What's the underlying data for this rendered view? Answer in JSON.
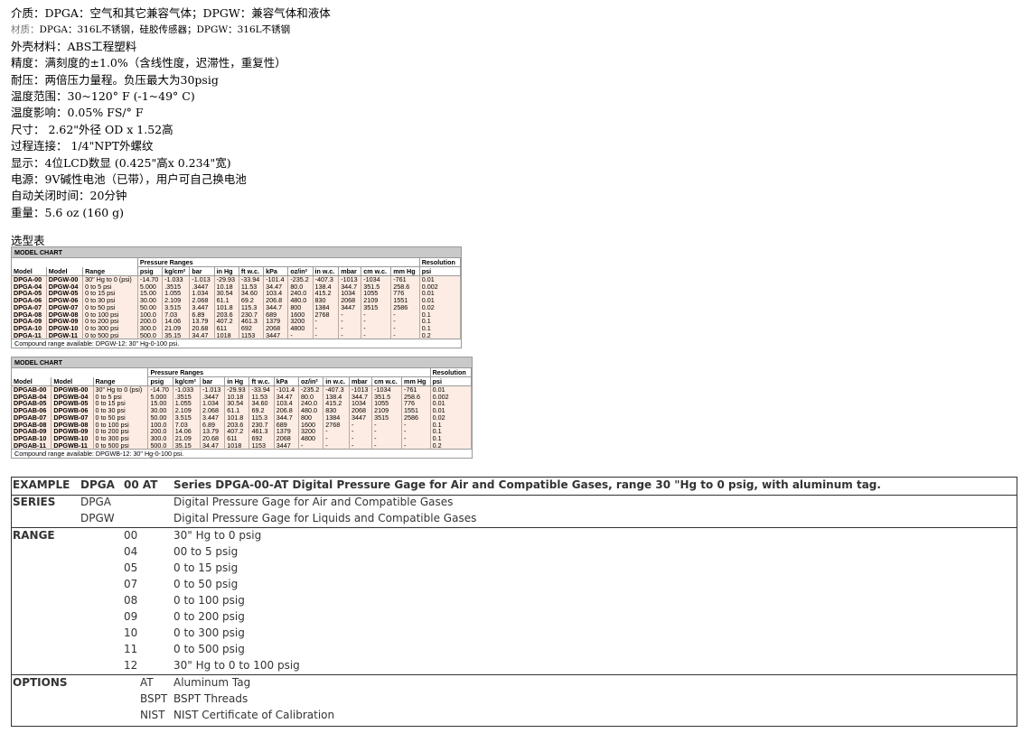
{
  "specs": [
    {
      "text": "介质：DPGA：空气和其它兼容气体；DPGW：兼容气体和液体",
      "style": "normal"
    },
    {
      "label": "材质：",
      "text": "DPGA：316L不锈钢，硅胶传感器；DPGW：316L不锈钢",
      "style": "small"
    },
    {
      "text": "外壳材料：ABS工程塑料",
      "style": "normal"
    },
    {
      "text": "精度：满刻度的±1.0%（含线性度，迟滞性，重复性）",
      "style": "normal"
    },
    {
      "text": "耐压：两倍压力量程。负压最大为30psig",
      "style": "normal"
    },
    {
      "text": "温度范围：30~120° F (-1~49° C)",
      "style": "normal"
    },
    {
      "text": "温度影响：0.05% FS/° F",
      "style": "normal"
    },
    {
      "text": "尺寸： 2.62\"外径 OD x 1.52高",
      "style": "normal"
    },
    {
      "text": "过程连接： 1/4\"NPT外螺纹",
      "style": "normal"
    },
    {
      "text": "显示：4位LCD数显 (0.425\"高x 0.234\"宽)",
      "style": "normal"
    },
    {
      "text": "电源：9V碱性电池（已带），用户可自己换电池",
      "style": "normal"
    },
    {
      "text": "自动关闭时间：20分钟",
      "style": "normal"
    },
    {
      "text": "重量：5.6 oz (160 g)",
      "style": "normal"
    }
  ],
  "selection_heading": "选型表",
  "charts": [
    {
      "title": "MODEL CHART",
      "group_header": "Pressure Ranges",
      "resolution_header": "Resolution",
      "columns": [
        "Model",
        "Model",
        "Range",
        "psig",
        "kg/cm²",
        "bar",
        "in Hg",
        "ft w.c.",
        "kPa",
        "oz/in²",
        "in w.c.",
        "mbar",
        "cm w.c.",
        "mm Hg",
        "psi"
      ],
      "rows": [
        [
          "DPGA-00",
          "DPGW-00",
          "30\" Hg to 0 (psi)",
          "-14.70",
          "-1.033",
          "-1.013",
          "-29.93",
          "-33.94",
          "-101.4",
          "-235.2",
          "-407.3",
          "-1013",
          "-1034",
          "-761",
          "0.01"
        ],
        [
          "DPGA-04",
          "DPGW-04",
          "0 to 5 psi",
          "5.000",
          ".3515",
          ".3447",
          "10.18",
          "11.53",
          "34.47",
          "80.0",
          "138.4",
          "344.7",
          "351.5",
          "258.6",
          "0.002"
        ],
        [
          "DPGA-05",
          "DPGW-05",
          "0 to 15 psi",
          "15.00",
          "1.055",
          "1.034",
          "30.54",
          "34.60",
          "103.4",
          "240.0",
          "415.2",
          "1034",
          "1055",
          "776",
          "0.01"
        ],
        [
          "DPGA-06",
          "DPGW-06",
          "0 to 30 psi",
          "30.00",
          "2.109",
          "2.068",
          "61.1",
          "69.2",
          "206.8",
          "480.0",
          "830",
          "2068",
          "2109",
          "1551",
          "0.01"
        ],
        [
          "DPGA-07",
          "DPGW-07",
          "0 to 50 psi",
          "50.00",
          "3.515",
          "3.447",
          "101.8",
          "115.3",
          "344.7",
          "800",
          "1384",
          "3447",
          "3515",
          "2586",
          "0.02"
        ],
        [
          "DPGA-08",
          "DPGW-08",
          "0 to 100 psi",
          "100.0",
          "7.03",
          "6.89",
          "203.6",
          "230.7",
          "689",
          "1600",
          "2768",
          "-",
          "-",
          "-",
          "0.1"
        ],
        [
          "DPGA-09",
          "DPGW-09",
          "0 to 200 psi",
          "200.0",
          "14.06",
          "13.79",
          "407.2",
          "461.3",
          "1379",
          "3200",
          "-",
          "-",
          "-",
          "-",
          "0.1"
        ],
        [
          "DPGA-10",
          "DPGW-10",
          "0 to 300 psi",
          "300.0",
          "21.09",
          "20.68",
          "611",
          "692",
          "2068",
          "4800",
          "-",
          "-",
          "-",
          "-",
          "0.1"
        ],
        [
          "DPGA-11",
          "DPGW-11",
          "0 to 500 psi",
          "500.0",
          "35.15",
          "34.47",
          "1018",
          "1153",
          "3447",
          "-",
          "-",
          "-",
          "-",
          "-",
          "0.2"
        ]
      ],
      "footnote": "Compound range available: DPGW-12: 30\" Hg-0-100 psi."
    },
    {
      "title": "MODEL CHART",
      "group_header": "Pressure Ranges",
      "resolution_header": "Resolution",
      "columns": [
        "Model",
        "Model",
        "Range",
        "psig",
        "kg/cm²",
        "bar",
        "in Hg",
        "ft w.c.",
        "kPa",
        "oz/in²",
        "in w.c.",
        "mbar",
        "cm w.c.",
        "mm Hg",
        "psi"
      ],
      "rows": [
        [
          "DPGAB-00",
          "DPGWB-00",
          "30\" Hg to 0 (psi)",
          "-14.70",
          "-1.033",
          "-1.013",
          "-29.93",
          "-33.94",
          "-101.4",
          "-235.2",
          "-407.3",
          "-1013",
          "-1034",
          "-761",
          "0.01"
        ],
        [
          "DPGAB-04",
          "DPGWB-04",
          "0 to 5 psi",
          "5.000",
          ".3515",
          ".3447",
          "10.18",
          "11.53",
          "34.47",
          "80.0",
          "138.4",
          "344.7",
          "351.5",
          "258.6",
          "0.002"
        ],
        [
          "DPGAB-05",
          "DPGWB-05",
          "0 to 15 psi",
          "15.00",
          "1.055",
          "1.034",
          "30.54",
          "34.60",
          "103.4",
          "240.0",
          "415.2",
          "1034",
          "1055",
          "776",
          "0.01"
        ],
        [
          "DPGAB-06",
          "DPGWB-06",
          "0 to 30 psi",
          "30.00",
          "2.109",
          "2.068",
          "61.1",
          "69.2",
          "206.8",
          "480.0",
          "830",
          "2068",
          "2109",
          "1551",
          "0.01"
        ],
        [
          "DPGAB-07",
          "DPGWB-07",
          "0 to 50 psi",
          "50.00",
          "3.515",
          "3.447",
          "101.8",
          "115.3",
          "344.7",
          "800",
          "1384",
          "3447",
          "3515",
          "2586",
          "0.02"
        ],
        [
          "DPGAB-08",
          "DPGWB-08",
          "0 to 100 psi",
          "100.0",
          "7.03",
          "6.89",
          "203.6",
          "230.7",
          "689",
          "1600",
          "2768",
          "-",
          "-",
          "-",
          "0.1"
        ],
        [
          "DPGAB-09",
          "DPGWB-09",
          "0 to 200 psi",
          "200.0",
          "14.06",
          "13.79",
          "407.2",
          "461.3",
          "1379",
          "3200",
          "-",
          "-",
          "-",
          "-",
          "0.1"
        ],
        [
          "DPGAB-10",
          "DPGWB-10",
          "0 to 300 psi",
          "300.0",
          "21.09",
          "20.68",
          "611",
          "692",
          "2068",
          "4800",
          "-",
          "-",
          "-",
          "-",
          "0.1"
        ],
        [
          "DPGAB-11",
          "DPGWB-11",
          "0 to 500 psi",
          "500.0",
          "35.15",
          "34.47",
          "1018",
          "1153",
          "3447",
          "-",
          "-",
          "-",
          "-",
          "-",
          "0.2"
        ]
      ],
      "footnote": "Compound range available: DPGWB-12: 30\" Hg-0-100 psi."
    }
  ],
  "ordering": {
    "example": {
      "label": "EXAMPLE",
      "model": "DPGA",
      "code": "00 AT",
      "description": "Series DPGA-00-AT Digital Pressure Gage for Air and Compatible Gases, range 30 \"Hg to 0 psig, with aluminum tag."
    },
    "series": {
      "label": "SERIES",
      "items": [
        {
          "code": "DPGA",
          "text": "Digital Pressure Gage for Air and Compatible Gases"
        },
        {
          "code": "DPGW",
          "text": "Digital Pressure Gage for Liquids and Compatible Gases"
        }
      ]
    },
    "range": {
      "label": "RANGE",
      "items": [
        {
          "code": "00",
          "text": "30\" Hg to 0 psig"
        },
        {
          "code": "04",
          "text": "00 to 5 psig"
        },
        {
          "code": "05",
          "text": "0 to 15 psig"
        },
        {
          "code": "07",
          "text": "0 to 50 psig"
        },
        {
          "code": "08",
          "text": "0 to 100 psig"
        },
        {
          "code": "09",
          "text": "0 to 200 psig"
        },
        {
          "code": "10",
          "text": "0 to 300 psig"
        },
        {
          "code": "11",
          "text": "0 to 500 psig"
        },
        {
          "code": "12",
          "text": "30\" Hg to 0 to 100 psig"
        }
      ]
    },
    "options": {
      "label": "OPTIONS",
      "items": [
        {
          "code": "AT",
          "text": "Aluminum Tag"
        },
        {
          "code": "BSPT",
          "text": "BSPT Threads"
        },
        {
          "code": "NIST",
          "text": "NIST Certificate of Calibration"
        }
      ]
    }
  }
}
